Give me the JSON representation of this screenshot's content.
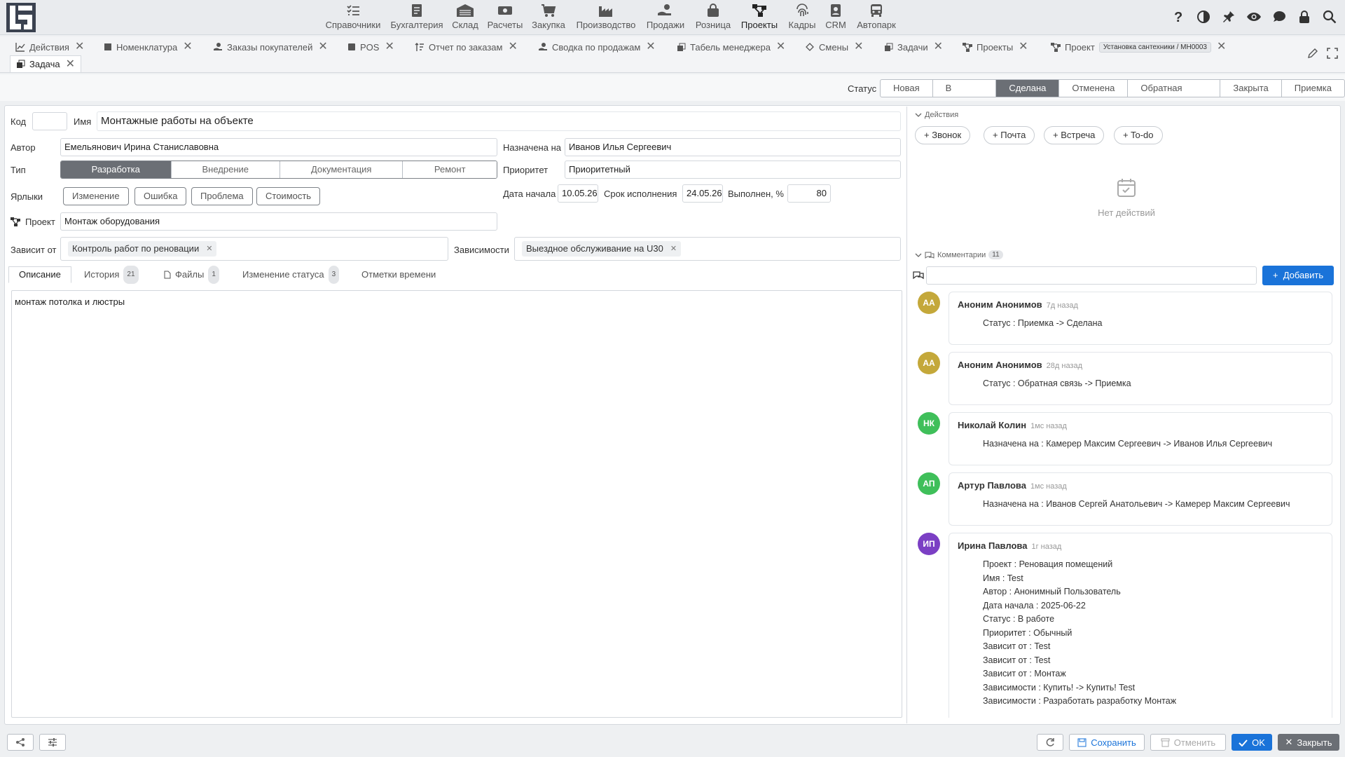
{
  "nav": {
    "items": [
      {
        "label": "Справочники",
        "icon": "list-check-icon"
      },
      {
        "label": "Бухгалтерия",
        "icon": "ledger-icon"
      },
      {
        "label": "Склад",
        "icon": "warehouse-icon"
      },
      {
        "label": "Расчеты",
        "icon": "money-icon"
      },
      {
        "label": "Закупка",
        "icon": "cart-icon"
      },
      {
        "label": "Производство",
        "icon": "factory-icon"
      },
      {
        "label": "Продажи",
        "icon": "hand-coin-icon"
      },
      {
        "label": "Розница",
        "icon": "bag-icon"
      },
      {
        "label": "Проекты",
        "icon": "project-icon"
      },
      {
        "label": "Кадры",
        "icon": "fingerprint-icon"
      },
      {
        "label": "CRM",
        "icon": "contact-icon"
      },
      {
        "label": "Автопарк",
        "icon": "bus-icon"
      }
    ],
    "active": "Проекты"
  },
  "tabs": [
    {
      "label": "Действия"
    },
    {
      "label": "Номенклатура"
    },
    {
      "label": "Заказы покупателей"
    },
    {
      "label": "POS"
    },
    {
      "label": "Отчет по заказам"
    },
    {
      "label": "Сводка по продажам"
    },
    {
      "label": "Табель менеджера"
    },
    {
      "label": "Смены"
    },
    {
      "label": "Задачи"
    },
    {
      "label": "Проекты"
    },
    {
      "label": "Проект",
      "tag": "Установка сантехники / MH0003"
    },
    {
      "label": "Задача"
    }
  ],
  "status": {
    "label": "Статус",
    "options": [
      "Новая",
      "В работе",
      "Сделана",
      "Отменена",
      "Обратная связь",
      "Закрыта",
      "Приемка"
    ],
    "selected": "Сделана"
  },
  "form": {
    "code_label": "Код",
    "code_value": "",
    "name_label": "Имя",
    "name_value": "Монтажные работы на объекте",
    "author_label": "Автор",
    "author_value": "Емельянович Ирина Станиславовна",
    "assigned_label": "Назначена на",
    "assigned_value": "Иванов Илья Сергеевич",
    "type_label": "Тип",
    "type_options": [
      "Разработка",
      "Внедрение",
      "Документация",
      "Ремонт"
    ],
    "type_selected": "Разработка",
    "priority_label": "Приоритет",
    "priority_value": "Приоритетный",
    "labels_label": "Ярлыки",
    "labels": [
      "Изменение",
      "Ошибка",
      "Проблема",
      "Стоимость"
    ],
    "start_label": "Дата начала",
    "start_value": "10.05.26",
    "due_label": "Срок исполнения",
    "due_value": "24.05.26",
    "done_label": "Выполнен, %",
    "done_value": "80",
    "project_label": "Проект",
    "project_value": "Монтаж оборудования",
    "depends_on_label": "Зависит от",
    "depends_on": [
      "Контроль работ по реновации"
    ],
    "dependencies_label": "Зависимости",
    "dependencies": [
      "Выездное обслуживание на U30"
    ]
  },
  "subtabs": [
    {
      "label": "Описание"
    },
    {
      "label": "История",
      "badge": "21"
    },
    {
      "label": "Файлы",
      "badge": "1"
    },
    {
      "label": "Изменение статуса",
      "badge": "3"
    },
    {
      "label": "Отметки времени"
    }
  ],
  "description": "монтаж потолка и люстры",
  "actions": {
    "header": "Действия",
    "buttons": [
      "Звонок",
      "Почта",
      "Встреча",
      "To-do"
    ],
    "empty": "Нет действий"
  },
  "comments": {
    "header": "Комментарии",
    "count": "11",
    "add_label": "Добавить",
    "items": [
      {
        "initials": "АА",
        "color": "#c4a83a",
        "author": "Аноним Анонимов",
        "when": "7д назад",
        "lines": [
          "Статус : Приемка -> Сделана"
        ]
      },
      {
        "initials": "АА",
        "color": "#c4a83a",
        "author": "Аноним Анонимов",
        "when": "28д назад",
        "lines": [
          "Статус : Обратная связь -> Приемка"
        ]
      },
      {
        "initials": "НК",
        "color": "#3fbf5a",
        "author": "Николай Колин",
        "when": "1мс назад",
        "lines": [
          "Назначена на : Камерер Максим Сергеевич -> Иванов Илья Сергеевич"
        ]
      },
      {
        "initials": "АП",
        "color": "#3fbf5a",
        "author": "Артур Павлова",
        "when": "1мс назад",
        "lines": [
          "Назначена на : Иванов Сергей Анатольевич -> Камерер Максим Сергеевич"
        ]
      },
      {
        "initials": "ИП",
        "color": "#7b3fc4",
        "author": "Ирина Павлова",
        "when": "1г назад",
        "lines": [
          "Проект : Реновация помещений",
          "Имя : Test",
          "Автор : Анонимный Пользователь",
          "Дата начала : 2025-06-22",
          "Статус : В работе",
          "Приоритет : Обычный",
          "Зависит от : Test",
          "Зависит от : Test",
          "Зависит от : Монтаж",
          "Зависимости : Купить! -> Купить! Test",
          "Зависимости : Разработать разработку Монтаж"
        ]
      }
    ]
  },
  "footer": {
    "save": "Сохранить",
    "cancel": "Отменить",
    "ok": "OK",
    "close": "Закрыть"
  }
}
